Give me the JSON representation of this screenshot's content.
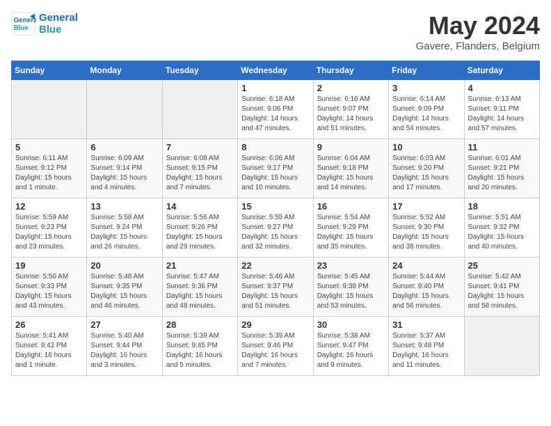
{
  "logo": {
    "line1": "General",
    "line2": "Blue"
  },
  "title": "May 2024",
  "location": "Gavere, Flanders, Belgium",
  "days_of_week": [
    "Sunday",
    "Monday",
    "Tuesday",
    "Wednesday",
    "Thursday",
    "Friday",
    "Saturday"
  ],
  "weeks": [
    [
      {
        "num": "",
        "info": ""
      },
      {
        "num": "",
        "info": ""
      },
      {
        "num": "",
        "info": ""
      },
      {
        "num": "1",
        "info": "Sunrise: 6:18 AM\nSunset: 9:06 PM\nDaylight: 14 hours\nand 47 minutes."
      },
      {
        "num": "2",
        "info": "Sunrise: 6:16 AM\nSunset: 9:07 PM\nDaylight: 14 hours\nand 51 minutes."
      },
      {
        "num": "3",
        "info": "Sunrise: 6:14 AM\nSunset: 9:09 PM\nDaylight: 14 hours\nand 54 minutes."
      },
      {
        "num": "4",
        "info": "Sunrise: 6:13 AM\nSunset: 9:11 PM\nDaylight: 14 hours\nand 57 minutes."
      }
    ],
    [
      {
        "num": "5",
        "info": "Sunrise: 6:11 AM\nSunset: 9:12 PM\nDaylight: 15 hours\nand 1 minute."
      },
      {
        "num": "6",
        "info": "Sunrise: 6:09 AM\nSunset: 9:14 PM\nDaylight: 15 hours\nand 4 minutes."
      },
      {
        "num": "7",
        "info": "Sunrise: 6:08 AM\nSunset: 9:15 PM\nDaylight: 15 hours\nand 7 minutes."
      },
      {
        "num": "8",
        "info": "Sunrise: 6:06 AM\nSunset: 9:17 PM\nDaylight: 15 hours\nand 10 minutes."
      },
      {
        "num": "9",
        "info": "Sunrise: 6:04 AM\nSunset: 9:18 PM\nDaylight: 15 hours\nand 14 minutes."
      },
      {
        "num": "10",
        "info": "Sunrise: 6:03 AM\nSunset: 9:20 PM\nDaylight: 15 hours\nand 17 minutes."
      },
      {
        "num": "11",
        "info": "Sunrise: 6:01 AM\nSunset: 9:21 PM\nDaylight: 15 hours\nand 20 minutes."
      }
    ],
    [
      {
        "num": "12",
        "info": "Sunrise: 5:59 AM\nSunset: 9:23 PM\nDaylight: 15 hours\nand 23 minutes."
      },
      {
        "num": "13",
        "info": "Sunrise: 5:58 AM\nSunset: 9:24 PM\nDaylight: 15 hours\nand 26 minutes."
      },
      {
        "num": "14",
        "info": "Sunrise: 5:56 AM\nSunset: 9:26 PM\nDaylight: 15 hours\nand 29 minutes."
      },
      {
        "num": "15",
        "info": "Sunrise: 5:55 AM\nSunset: 9:27 PM\nDaylight: 15 hours\nand 32 minutes."
      },
      {
        "num": "16",
        "info": "Sunrise: 5:54 AM\nSunset: 9:29 PM\nDaylight: 15 hours\nand 35 minutes."
      },
      {
        "num": "17",
        "info": "Sunrise: 5:52 AM\nSunset: 9:30 PM\nDaylight: 15 hours\nand 38 minutes."
      },
      {
        "num": "18",
        "info": "Sunrise: 5:51 AM\nSunset: 9:32 PM\nDaylight: 15 hours\nand 40 minutes."
      }
    ],
    [
      {
        "num": "19",
        "info": "Sunrise: 5:50 AM\nSunset: 9:33 PM\nDaylight: 15 hours\nand 43 minutes."
      },
      {
        "num": "20",
        "info": "Sunrise: 5:48 AM\nSunset: 9:35 PM\nDaylight: 15 hours\nand 46 minutes."
      },
      {
        "num": "21",
        "info": "Sunrise: 5:47 AM\nSunset: 9:36 PM\nDaylight: 15 hours\nand 48 minutes."
      },
      {
        "num": "22",
        "info": "Sunrise: 5:46 AM\nSunset: 9:37 PM\nDaylight: 15 hours\nand 51 minutes."
      },
      {
        "num": "23",
        "info": "Sunrise: 5:45 AM\nSunset: 9:39 PM\nDaylight: 15 hours\nand 53 minutes."
      },
      {
        "num": "24",
        "info": "Sunrise: 5:44 AM\nSunset: 9:40 PM\nDaylight: 15 hours\nand 56 minutes."
      },
      {
        "num": "25",
        "info": "Sunrise: 5:42 AM\nSunset: 9:41 PM\nDaylight: 15 hours\nand 58 minutes."
      }
    ],
    [
      {
        "num": "26",
        "info": "Sunrise: 5:41 AM\nSunset: 9:42 PM\nDaylight: 16 hours\nand 1 minute."
      },
      {
        "num": "27",
        "info": "Sunrise: 5:40 AM\nSunset: 9:44 PM\nDaylight: 16 hours\nand 3 minutes."
      },
      {
        "num": "28",
        "info": "Sunrise: 5:39 AM\nSunset: 9:45 PM\nDaylight: 16 hours\nand 5 minutes."
      },
      {
        "num": "29",
        "info": "Sunrise: 5:39 AM\nSunset: 9:46 PM\nDaylight: 16 hours\nand 7 minutes."
      },
      {
        "num": "30",
        "info": "Sunrise: 5:38 AM\nSunset: 9:47 PM\nDaylight: 16 hours\nand 9 minutes."
      },
      {
        "num": "31",
        "info": "Sunrise: 5:37 AM\nSunset: 9:48 PM\nDaylight: 16 hours\nand 11 minutes."
      },
      {
        "num": "",
        "info": ""
      }
    ]
  ]
}
